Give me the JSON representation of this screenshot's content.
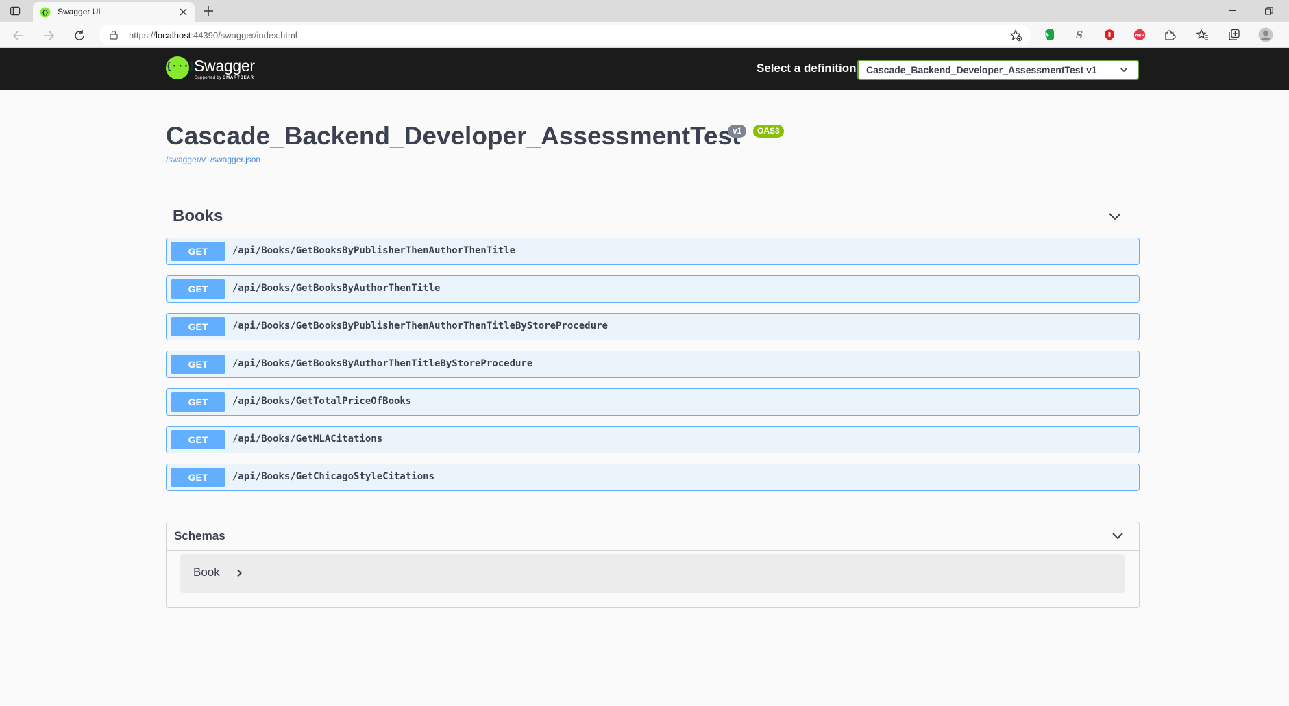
{
  "browser": {
    "tab_title": "Swagger UI",
    "url_prefix": "https://",
    "url_host": "localhost",
    "url_rest": ":44390/swagger/index.html"
  },
  "topbar": {
    "logo_text": "Swagger",
    "logo_sub_small": "Supported by",
    "logo_sub_brand": "SMARTBEAR",
    "definition_label": "Select a definition",
    "definition_selected": "Cascade_Backend_Developer_AssessmentTest v1"
  },
  "info": {
    "title": "Cascade_Backend_Developer_AssessmentTest",
    "version_badge": "v1",
    "oas_badge": "OAS3",
    "spec_link": "/swagger/v1/swagger.json"
  },
  "tag": {
    "name": "Books",
    "operations": [
      {
        "method": "GET",
        "path": "/api/Books/GetBooksByPublisherThenAuthorThenTitle"
      },
      {
        "method": "GET",
        "path": "/api/Books/GetBooksByAuthorThenTitle"
      },
      {
        "method": "GET",
        "path": "/api/Books/GetBooksByPublisherThenAuthorThenTitleByStoreProcedure"
      },
      {
        "method": "GET",
        "path": "/api/Books/GetBooksByAuthorThenTitleByStoreProcedure"
      },
      {
        "method": "GET",
        "path": "/api/Books/GetTotalPriceOfBooks"
      },
      {
        "method": "GET",
        "path": "/api/Books/GetMLACitations"
      },
      {
        "method": "GET",
        "path": "/api/Books/GetChicagoStyleCitations"
      }
    ]
  },
  "schemas": {
    "title": "Schemas",
    "models": [
      {
        "name": "Book"
      }
    ]
  },
  "colors": {
    "get_method": "#61affe",
    "get_background": "#ebf3fb",
    "topbar": "#1b1b1b",
    "swagger_green": "#85ea2d",
    "oas_badge": "#89bf04"
  }
}
